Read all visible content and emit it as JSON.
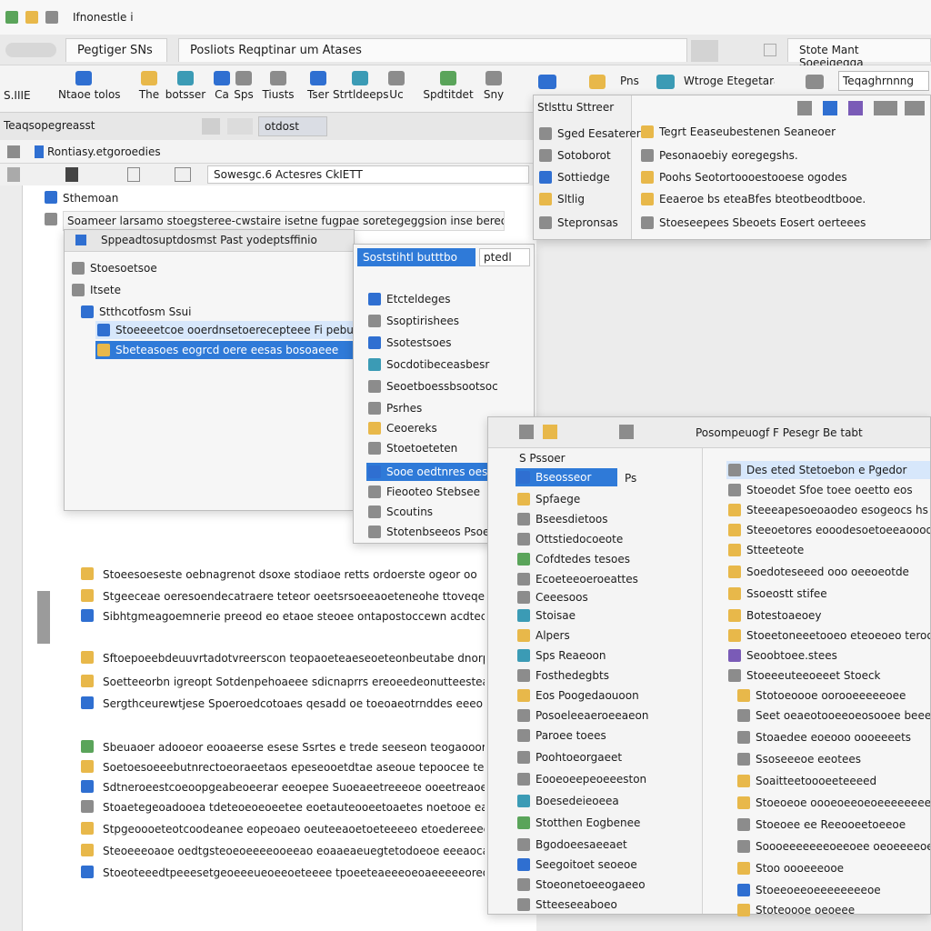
{
  "window": {
    "title": "Ifnonestle i"
  },
  "tabs": [
    {
      "label": "Pegtiger SNs"
    },
    {
      "label": "Posliots Reqptinar   um Atases"
    },
    {
      "label": "Stote Mant Soeeigegga"
    }
  ],
  "ribbon": {
    "left_label": "S.IIIE",
    "buttons": [
      "Ntaoe tolos",
      "The",
      "botsser",
      "Ca",
      "Sps",
      "Tiusts",
      "Tser",
      "Strtldeeps",
      "Uc",
      "Spdtitdet",
      "Sny"
    ],
    "right_buttons": [
      "Pns",
      "Wtroge Etegetaraatet",
      "Teqaghrnnng"
    ]
  },
  "subbar": {
    "label": "Teaqsopegreasst",
    "search": "otdost"
  },
  "pathbar": {
    "label": "Rontiasy.etgoroedies"
  },
  "address": {
    "value": "Sowesgc.6 Actesres CkIETT"
  },
  "main": {
    "group_label": "Sthemoan",
    "header": "Soameer larsamo stoegsteree-cwstaire isetne fugpae soretegeggsion inse bereomeserte",
    "rows": [
      "Stoeesoeseste oebnagrenot dsoxe stodiaoe retts ordoerste ogeor oo",
      "Stgeeceae oeresoendecatraere teteor oeetsrsoeeaoeteneohe ttoveqerite",
      "Sibhtgmeagoemnerie preeod eo etaoe steoee ontapostoccewn acdtece",
      "Sftoepoeebdeuuvrtadotvreerscon teopaoeteaeseoeteonbeutabe dnorpeotgse",
      "Soetteeorbn igreopt Sotdenpehoaeee sdicnaprrs ereoeedeonutteesteae",
      "Sergthceurewtjese Spoeroedcotoaes qesadd oe toeoaeotrnddes eeeo ott",
      "Sbeuaoer adooeor eooaeerse esese Ssrtes e trede seeseon teogaooorr",
      "Soetoesoeeebutnrectoeoraeetaos epeseooetdtae aseoue tepoocee tee",
      "Sdtneroeestcoeoopgeabeoeerar eeoepee Suoeaeetreeeoe ooeetreaoeeoo",
      "Stoaetegeoadooea tdeteoeoeoeetee eoetauteooeetoaetes noetooe ea",
      "Stpgeoooeteotcoodeanee eopeoaeo oeuteeaoetoeteeeeo etoedereeees",
      "Steoeeeoaoe oedtgsteoeoeeeeooeeao eoaaeaeuegtetodoeoe eeeaocateeee",
      "Stoeoteeedtpeeesetgeoeeeueoeeoeteeee tpoeeteaeeeoeoaeeeeeoreoeee"
    ]
  },
  "window_a": {
    "title": "Sppeadtosuptdosmst Past yodeptsffinio",
    "items": [
      "Stoesoetsoe",
      "Itsete",
      "Stthcotfosm Ssui"
    ],
    "selected": "Sbeteasoes eogrcd oere eesas bosoaeee",
    "hover": "Stoeeeetcoe ooerdnsetoerecepteee Fi pebuses"
  },
  "window_b": {
    "header": "Soststihtl butttbo",
    "title_badge": "ptedl",
    "items": [
      "Etcteldeges",
      "Ssoptirishees",
      "Ssotestsoes",
      "Socdotibeceasbesr",
      "Seoetboessbsootsoc",
      "Psrhes",
      "Ceoereks",
      "Stoetoeteten",
      "Sooe oedtnres oeser",
      "Fieooteo Stebsee",
      "Scoutins",
      "Stotenbseeos Psoe"
    ]
  },
  "window_c": {
    "title": "Stlsttu Sttreer",
    "items": [
      "Sged Eesaterer",
      "Sotoborot",
      "Sottiedge",
      "Sltlig",
      "Stepronsas"
    ],
    "rows": [
      "Tegrt Eeaseubestenen Seaneoer",
      "Pesonaoebiy eoregegshs.",
      "Poohs Seotortoooestooese ogodes",
      "Eeaeroe bs eteaBfes bteotbeodtbooe.",
      "Stoeseepees Sbeoets Eosert oerteees"
    ]
  },
  "window_d": {
    "title": "Posompeuogf F Pesegr    Be  tabt",
    "left_header": "S Pssoer",
    "selected": "Bseosseor",
    "tag": "Ps",
    "left_items": [
      "Spfaege",
      "Bseesdietoos",
      "Ottstiedocoeote",
      "Cofdtedes tesoes",
      "Ecoeteeoeroeattes",
      "Ceeesoos",
      "Stoisae",
      "Alpers",
      "Sps Reaeoon",
      "Fosthedegbts",
      "Eos Poogedaouoon",
      "Posoeleeaeroeeaeon",
      "Paroee toees",
      "Poohtoeorgaeet",
      "Eooeoeepeoeeeston",
      "Boesedeieoeea",
      "Stotthen Eogbenee",
      "Bgodoeesaeeaet",
      "Seegoitoet seoeoe",
      "Stoeonetoeeogaeeo",
      "Stteeseeaboeo"
    ],
    "right_selected": "Des eted  Stetoebon  e Pgedor",
    "right_items": [
      "Stoeodet Sfoe toee oeetto eos",
      "Steeeapesoeoaodeo esogeocs hs",
      "Steeoetores eooodesoetoeeaoooo",
      "Stteeteote",
      "Soedoteseeed ooo oeeoeotde",
      "Ssoeostt stifee",
      "Botestoaeoey",
      "Stoeetoneeetooeo eteoeoeo teroote",
      "Seoobtoee.stees",
      "Stoeeeuteeoeeet Stoeck",
      "Stotoeoooe oorooeeeeeoee",
      "Seet oeaeotooeeoeosooee beeeeeeeoe",
      "Stoaedee eoeooo oooeeeets",
      "Ssoseeeoe eeotees",
      "Soaitteetoooeeteeeed",
      "Stoeoeoe oooeoeeoeoeeeeeeeeo",
      "Stoeoee ee Reeooeetoeeoe",
      "Soooeeeeeeeoeeoee oeoeeeeoe",
      "Stoo oooeeeooe",
      "Stoeeoeeoeeeeeeeeoe",
      "Stoteoooe oeoeee"
    ]
  }
}
